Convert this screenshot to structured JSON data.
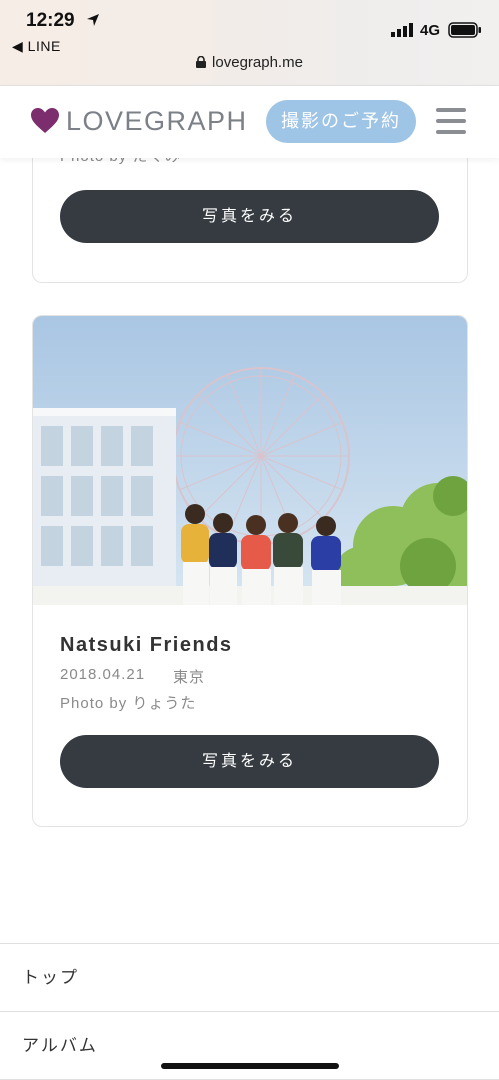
{
  "status_bar": {
    "time": "12:29",
    "back_app": "◀ LINE",
    "network": "4G"
  },
  "browser": {
    "url": "lovegraph.me"
  },
  "header": {
    "logo_text": "LOVEGRAPH",
    "book_button": "撮影のご予約",
    "brand_color": "#7b2d6e",
    "book_color": "#9ec4e6"
  },
  "cards": [
    {
      "photographer_partial": "Photo by たくみ",
      "view_button": "写真をみる"
    },
    {
      "title": "Natsuki Friends",
      "date": "2018.04.21",
      "place": "東京",
      "photographer": "Photo by りょうた",
      "view_button": "写真をみる"
    }
  ],
  "footer_nav": {
    "items": [
      "トップ",
      "アルバム"
    ]
  }
}
